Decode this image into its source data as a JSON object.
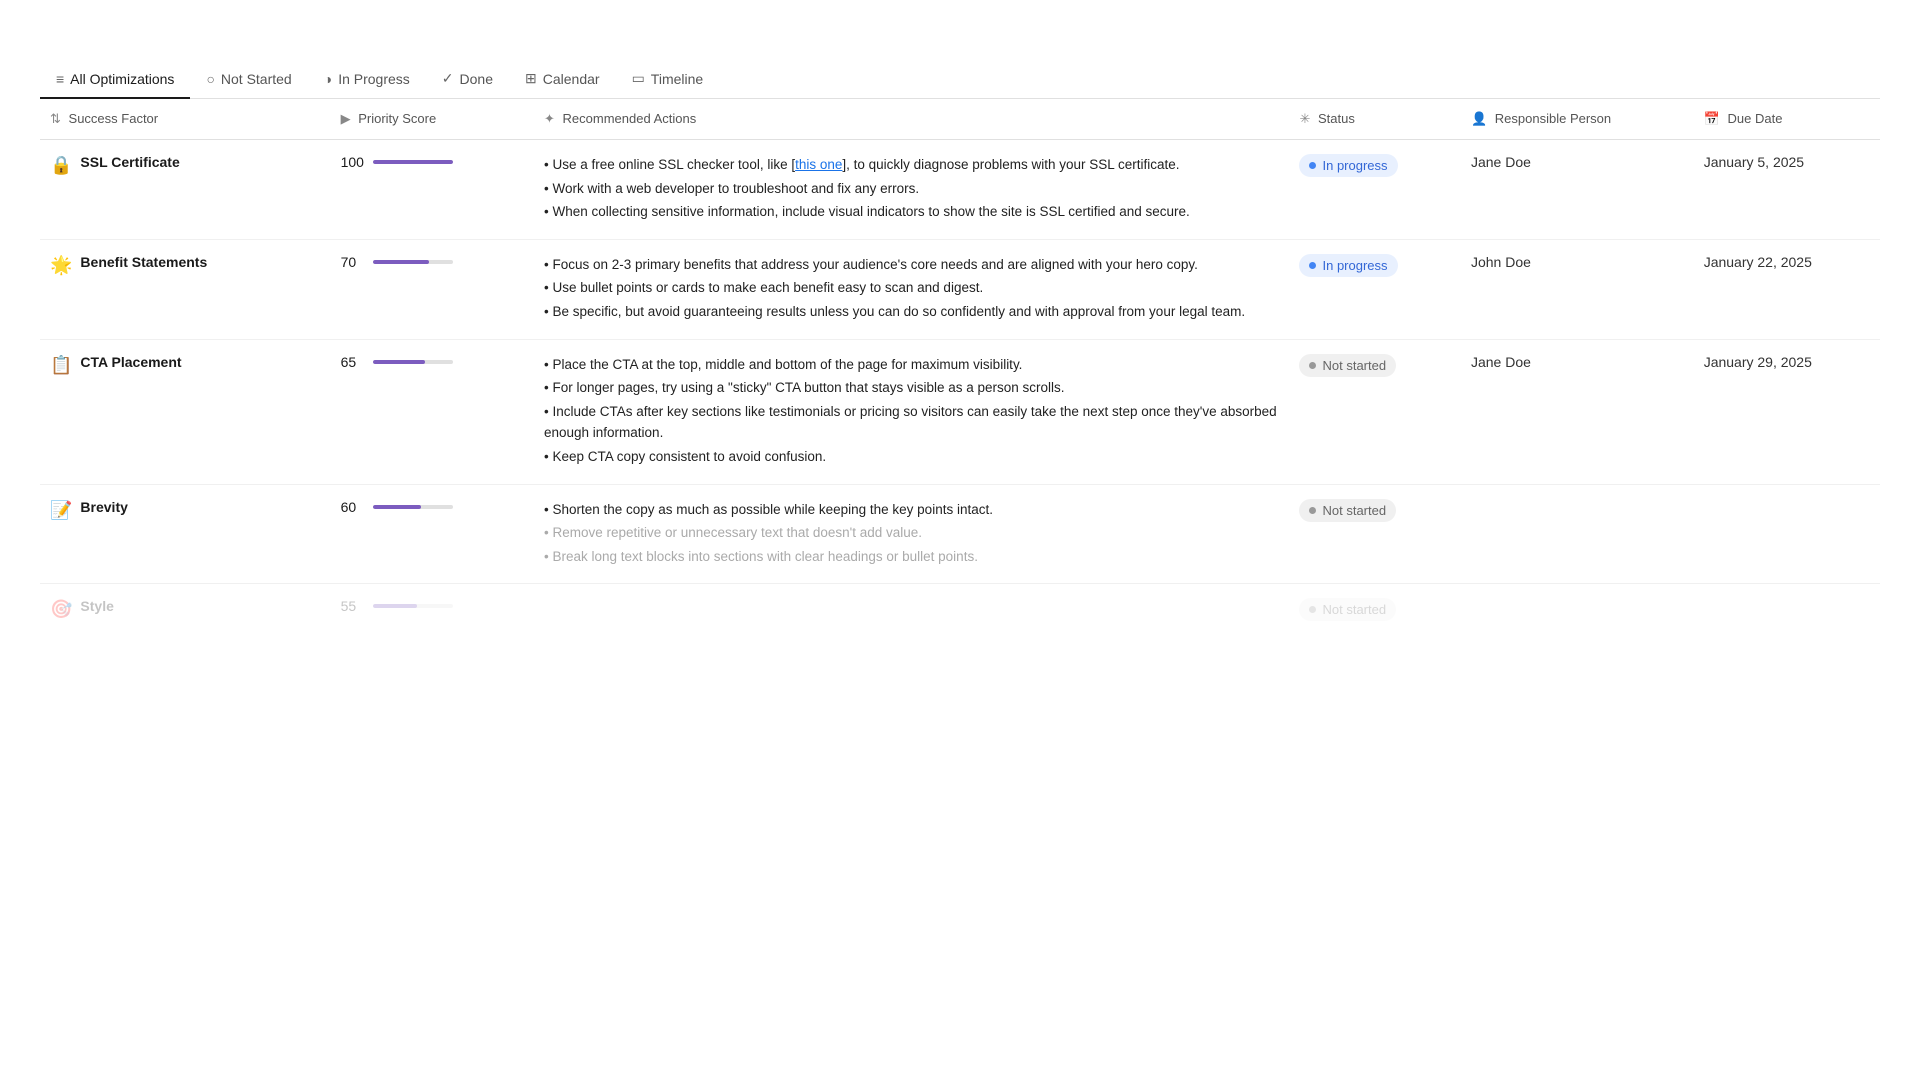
{
  "tabs": [
    {
      "id": "all",
      "label": "All Optimizations",
      "icon": "≡",
      "active": true
    },
    {
      "id": "not-started",
      "label": "Not Started",
      "icon": "○",
      "active": false
    },
    {
      "id": "in-progress",
      "label": "In Progress",
      "icon": "◑",
      "active": false
    },
    {
      "id": "done",
      "label": "Done",
      "icon": "✓",
      "active": false
    },
    {
      "id": "calendar",
      "label": "Calendar",
      "icon": "▦",
      "active": false
    },
    {
      "id": "timeline",
      "label": "Timeline",
      "icon": "▭",
      "active": false
    }
  ],
  "columns": {
    "success_factor": "Success Factor",
    "priority_score": "Priority Score",
    "recommended_actions": "Recommended Actions",
    "status": "Status",
    "responsible_person": "Responsible Person",
    "due_date": "Due Date"
  },
  "rows": [
    {
      "id": 1,
      "icon": "🔒",
      "name": "SSL Certificate",
      "score": 100,
      "score_pct": 100,
      "actions": [
        "• Use a free online SSL checker tool, like [this one], to quickly diagnose problems with your SSL certificate.",
        "• Work with a web developer to troubleshoot and fix any errors.",
        "• When collecting sensitive information, include visual indicators to show the site is SSL certified and secure."
      ],
      "has_link": true,
      "link_word": "this one",
      "status": "In progress",
      "status_type": "in-progress",
      "person": "Jane Doe",
      "due_date": "January 5, 2025"
    },
    {
      "id": 2,
      "icon": "🌟",
      "name": "Benefit Statements",
      "score": 70,
      "score_pct": 70,
      "actions": [
        "• Focus on 2-3 primary benefits that address your audience's core needs and are aligned with your hero copy.",
        "• Use bullet points or cards to make each benefit easy to scan and digest.",
        "• Be specific, but avoid guaranteeing results unless you can do so confidently and with approval from your legal team."
      ],
      "has_link": false,
      "status": "In progress",
      "status_type": "in-progress",
      "person": "John Doe",
      "due_date": "January 22, 2025"
    },
    {
      "id": 3,
      "icon": "📋",
      "name": "CTA Placement",
      "score": 65,
      "score_pct": 65,
      "actions": [
        "• Place the CTA at the top, middle and bottom of the page for maximum visibility.",
        "• For longer pages, try using a \"sticky\" CTA button that stays visible as a person scrolls.",
        "• Include CTAs after key sections like testimonials or pricing so visitors can easily take the next step once they've absorbed enough information.",
        "• Keep CTA copy consistent to avoid confusion."
      ],
      "has_link": false,
      "status": "Not started",
      "status_type": "not-started",
      "person": "Jane Doe",
      "due_date": "January 29, 2025"
    },
    {
      "id": 4,
      "icon": "📝",
      "name": "Brevity",
      "score": 60,
      "score_pct": 60,
      "actions": [
        "• Shorten the copy as much as possible while keeping the key points intact.",
        "• Remove repetitive or unnecessary text that doesn't add value.",
        "• Break long text blocks into sections with clear headings or bullet points."
      ],
      "has_link": false,
      "status": "Not started",
      "status_type": "not-started",
      "person": "",
      "due_date": ""
    },
    {
      "id": 5,
      "icon": "🎯",
      "name": "Style",
      "score": 55,
      "score_pct": 55,
      "actions": [
        ""
      ],
      "has_link": false,
      "status": "Not started",
      "status_type": "not-started",
      "person": "",
      "due_date": "",
      "ghost": true
    }
  ]
}
